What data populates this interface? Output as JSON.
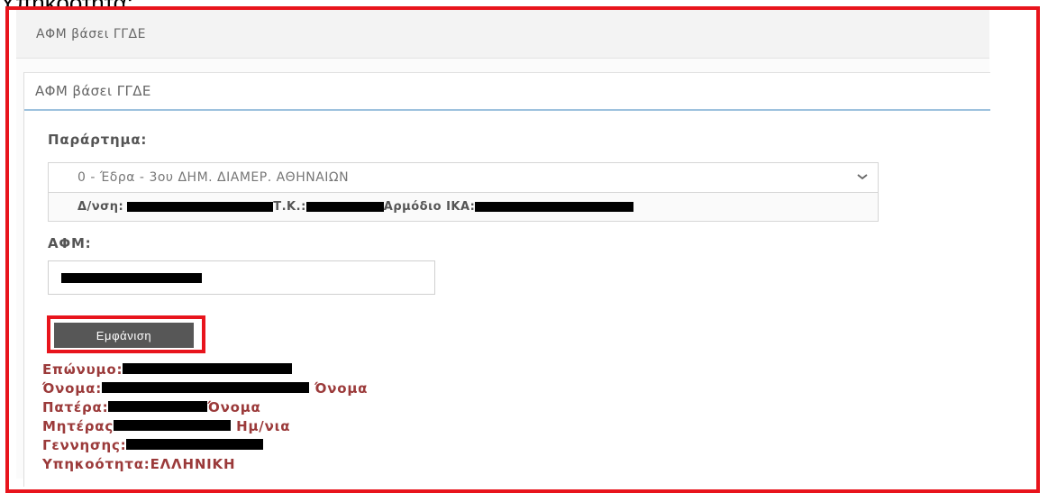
{
  "top_caption": "Υπηκοότητα:",
  "header": {
    "title": "ΑΦΜ βάσει ΓΓΔΕ"
  },
  "panel": {
    "title": "ΑΦΜ βάσει ΓΓΔΕ"
  },
  "branch": {
    "label": "Παράρτημα:",
    "selected": "0 - Έδρα - 3ου ΔΗΜ. ΔΙΑΜΕΡ. ΑΘΗΝΑΙΩΝ",
    "address_label": "Δ/νση:",
    "postal_code_label": "Τ.Κ.:",
    "ika_label": "Αρμόδιο ΙΚΑ:"
  },
  "afm": {
    "label": "ΑΦΜ:"
  },
  "show_button": {
    "label": "Εμφάνιση"
  },
  "results": {
    "surname_label": "Επώνυμο:",
    "name_label": "Όνομα:",
    "father_label_1": "Όνομα",
    "father_label_2": "Πατέρα:",
    "mother_label_1": "Όνομα",
    "mother_label_2": "Μητέρας",
    "birth_label_1": "Ημ/νια",
    "birth_label_2": "Γεννησης:",
    "citizenship": "Υπηκοότητα:ΕΛΛΗΝΙΚΗ"
  },
  "colors": {
    "highlight_red": "#e8141c",
    "result_text": "#9b3a3a",
    "button_bg": "#575757",
    "heading_underline": "#9dc2de"
  }
}
